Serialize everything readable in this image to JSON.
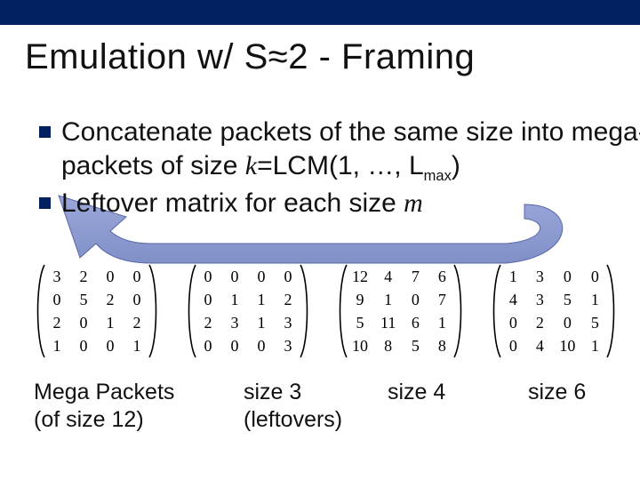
{
  "title": {
    "pre": "Emulation w/ S",
    "approx": "≈",
    "post": "2 - Framing"
  },
  "bullets": [
    {
      "plain1": "Concatenate packets of the same size into mega-packets of size ",
      "kvar": "k",
      "eq1": "=LCM(1, …, L",
      "sub1": "max",
      "eq1end": ")"
    },
    {
      "plain1": "Leftover matrix for each size ",
      "mvar": "m"
    }
  ],
  "matrices": [
    {
      "rows": [
        [
          "3",
          "2",
          "0",
          "0"
        ],
        [
          "0",
          "5",
          "2",
          "0"
        ],
        [
          "2",
          "0",
          "1",
          "2"
        ],
        [
          "1",
          "0",
          "0",
          "1"
        ]
      ]
    },
    {
      "rows": [
        [
          "0",
          "0",
          "0",
          "0"
        ],
        [
          "0",
          "1",
          "1",
          "2"
        ],
        [
          "2",
          "3",
          "1",
          "3"
        ],
        [
          "0",
          "0",
          "0",
          "3"
        ]
      ]
    },
    {
      "rows": [
        [
          "12",
          "4",
          "7",
          "6"
        ],
        [
          "9",
          "1",
          "0",
          "7"
        ],
        [
          "5",
          "11",
          "6",
          "1"
        ],
        [
          "10",
          "8",
          "5",
          "8"
        ]
      ]
    },
    {
      "rows": [
        [
          "1",
          "3",
          "0",
          "0"
        ],
        [
          "4",
          "3",
          "5",
          "1"
        ],
        [
          "0",
          "2",
          "0",
          "5"
        ],
        [
          "0",
          "4",
          "10",
          "1"
        ]
      ]
    }
  ],
  "captions": {
    "c1a": "Mega Packets",
    "c1b": "(of size 12)",
    "c2a": "size 3",
    "c2b": "(leftovers)",
    "c3": "size 4",
    "c4": "size 6"
  }
}
